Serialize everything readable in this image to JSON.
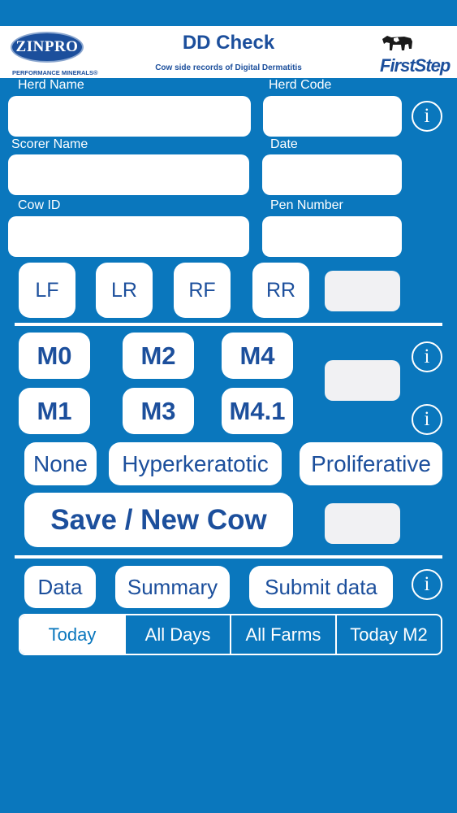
{
  "header": {
    "title": "DD Check",
    "subtitle": "Cow side records of Digital Dermatitis",
    "left_logo_text": "ZINPRO",
    "left_logo_subtext": "PERFORMANCE MINERALS®",
    "right_logo_text": "FirstStep"
  },
  "form": {
    "herd_name_label": "Herd Name",
    "herd_name_value": "",
    "herd_code_label": "Herd Code",
    "herd_code_value": "",
    "scorer_name_label": "Scorer Name",
    "scorer_name_value": "",
    "date_label": "Date",
    "date_value": "",
    "cow_id_label": "Cow ID",
    "cow_id_value": "",
    "pen_number_label": "Pen Number",
    "pen_number_value": ""
  },
  "feet": [
    "LF",
    "LR",
    "RF",
    "RR"
  ],
  "m_scores": [
    "M0",
    "M2",
    "M4",
    "M1",
    "M3",
    "M4.1"
  ],
  "lesions": [
    "None",
    "Hyperkeratotic",
    "Proliferative"
  ],
  "save_label": "Save / New Cow",
  "nav_buttons": [
    "Data",
    "Summary",
    "Submit data"
  ],
  "segments": {
    "options": [
      "Today",
      "All Days",
      "All Farms",
      "Today M2"
    ],
    "selected": "Today"
  },
  "icons": {
    "info": "info-icon",
    "info_glyph": "i"
  },
  "colors": {
    "background": "#0a77bd",
    "button_text": "#1c4f9c",
    "header_bg": "#ffffff"
  }
}
